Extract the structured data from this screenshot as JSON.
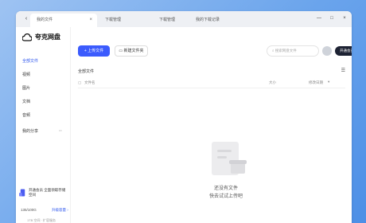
{
  "tabs": [
    "我的文件",
    "下载管理",
    "下载管理",
    "我的下载记录"
  ],
  "window_controls": [
    "—",
    "□",
    "×"
  ],
  "app": {
    "name": "夸克网盘"
  },
  "sidebar": {
    "items": [
      {
        "label": "全部文件"
      },
      {
        "label": "视频"
      },
      {
        "label": "图片"
      },
      {
        "label": "文档"
      },
      {
        "label": "音频"
      },
      {
        "label": "我的分享"
      }
    ],
    "promo": "开通会员 全面领取存储空间",
    "user": "135/100G",
    "upgrade": "升级容量 ›",
    "footer": "1TB 空间 · 扩容服务"
  },
  "toolbar": {
    "upload_label": "上传文件",
    "new_folder_label": "新建文件夹",
    "search_placeholder": "搜索网盘文件",
    "vip_label": "开通会员"
  },
  "main": {
    "breadcrumb": "全部文件",
    "columns": [
      "文件名",
      "大小",
      "修改日期"
    ],
    "empty_line1": "还没有文件",
    "empty_line2": "快去试试上传吧"
  },
  "colors": {
    "accent": "#3b5bfd",
    "background_gradient": "#6aa4ec"
  }
}
